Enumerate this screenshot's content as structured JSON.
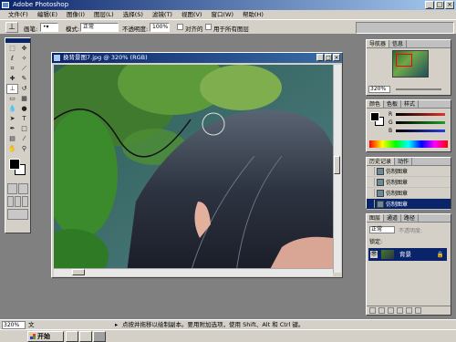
{
  "app": {
    "title": "Adobe Photoshop"
  },
  "menu": [
    "文件(F)",
    "编辑(E)",
    "图像(I)",
    "图层(L)",
    "选择(S)",
    "滤镜(T)",
    "视图(V)",
    "窗口(W)",
    "帮助(H)"
  ],
  "options": {
    "brush_label": "画笔:",
    "mode_label": "模式:",
    "mode_value": "正常",
    "opacity_label": "不透明度:",
    "opacity_value": "100%",
    "aligned_label": "对齐的",
    "use_all_layers_label": "用于所有图层"
  },
  "document": {
    "title": "换背景图7.jpg @ 320% (RGB)"
  },
  "navigator": {
    "tabs": [
      "导航器",
      "信息"
    ],
    "zoom": "320%"
  },
  "color_panel": {
    "tabs": [
      "颜色",
      "色板",
      "样式"
    ],
    "channels": [
      {
        "label": "R",
        "color": "#e0342a"
      },
      {
        "label": "G",
        "color": "#1c9c2a"
      },
      {
        "label": "B",
        "color": "#2a3ce0"
      }
    ]
  },
  "history_panel": {
    "tabs": [
      "历史记录",
      "动作"
    ],
    "items": [
      "仿制图章",
      "仿制图章",
      "仿制图章",
      "仿制图章"
    ]
  },
  "layers_panel": {
    "tabs": [
      "图层",
      "通道",
      "路径"
    ],
    "mode_value": "正常",
    "opacity_label": "不透明度:",
    "lock_label": "锁定:",
    "layer_name": "背景"
  },
  "status": {
    "zoom": "320%",
    "doc_label": "文",
    "hint": "点按并拖移以绘制副本。要用附加选项，使用 Shift、Alt 和 Ctrl 键。"
  },
  "taskbar": {
    "start_label": "开始"
  }
}
